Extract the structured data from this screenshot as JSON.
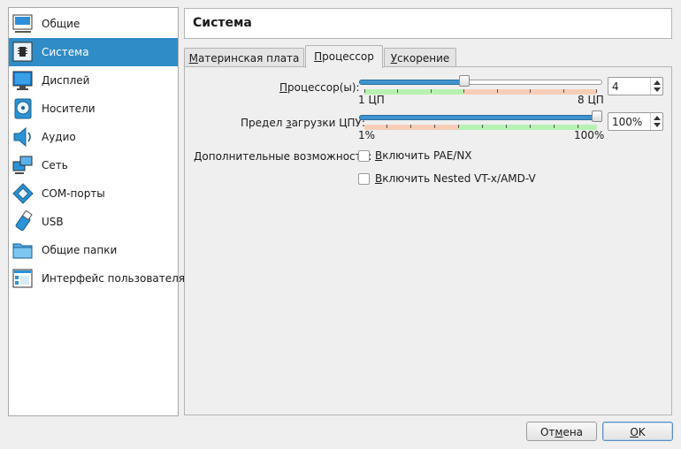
{
  "sidebar": {
    "items": [
      {
        "label": "Общие",
        "icon": "general-icon"
      },
      {
        "label": "Система",
        "icon": "system-icon"
      },
      {
        "label": "Дисплей",
        "icon": "display-icon"
      },
      {
        "label": "Носители",
        "icon": "storage-icon"
      },
      {
        "label": "Аудио",
        "icon": "audio-icon"
      },
      {
        "label": "Сеть",
        "icon": "network-icon"
      },
      {
        "label": "COM-порты",
        "icon": "serial-ports-icon"
      },
      {
        "label": "USB",
        "icon": "usb-icon"
      },
      {
        "label": "Общие папки",
        "icon": "shared-folders-icon"
      },
      {
        "label": "Интерфейс пользователя",
        "icon": "user-interface-icon"
      }
    ],
    "selected": "Система"
  },
  "header": {
    "title": "Система"
  },
  "tabs": [
    {
      "label_pre": "",
      "label_ul": "М",
      "label_post": "атеринская плата"
    },
    {
      "label_pre": "",
      "label_ul": "П",
      "label_post": "роцессор"
    },
    {
      "label_pre": "",
      "label_ul": "У",
      "label_post": "скорение"
    }
  ],
  "active_tab": "Процессор",
  "processor": {
    "cpu": {
      "label_pre": "",
      "label_ul": "П",
      "label_post": "роцессор(ы):",
      "min_label": "1 ЦП",
      "max_label": "8 ЦП",
      "value": "4",
      "min": 1,
      "max": 8,
      "current": 4
    },
    "cap": {
      "label_pre": "Предел ",
      "label_ul": "з",
      "label_post": "агрузки ЦПУ:",
      "min_label": "1%",
      "max_label": "100%",
      "value": "100%",
      "min": 1,
      "max": 100,
      "current": 100
    },
    "extended_label": "Дополнительные возможности:",
    "pae": {
      "label_pre": "",
      "label_ul": "В",
      "label_post": "ключить PAE/NX",
      "checked": false
    },
    "nested": {
      "label_pre": "",
      "label_ul": "В",
      "label_post": "ключить Nested VT-x/AMD-V",
      "checked": false
    }
  },
  "buttons": {
    "cancel": {
      "label_pre": "От",
      "label_ul": "м",
      "label_post": "ена"
    },
    "ok": {
      "label_pre": "",
      "label_ul": "O",
      "label_post": "K"
    }
  },
  "colors": {
    "accent": "#308cc6",
    "slider_fill": "#3f94cf",
    "zone_ok": "#b7f2b2",
    "zone_warn": "#f8cdb8"
  }
}
